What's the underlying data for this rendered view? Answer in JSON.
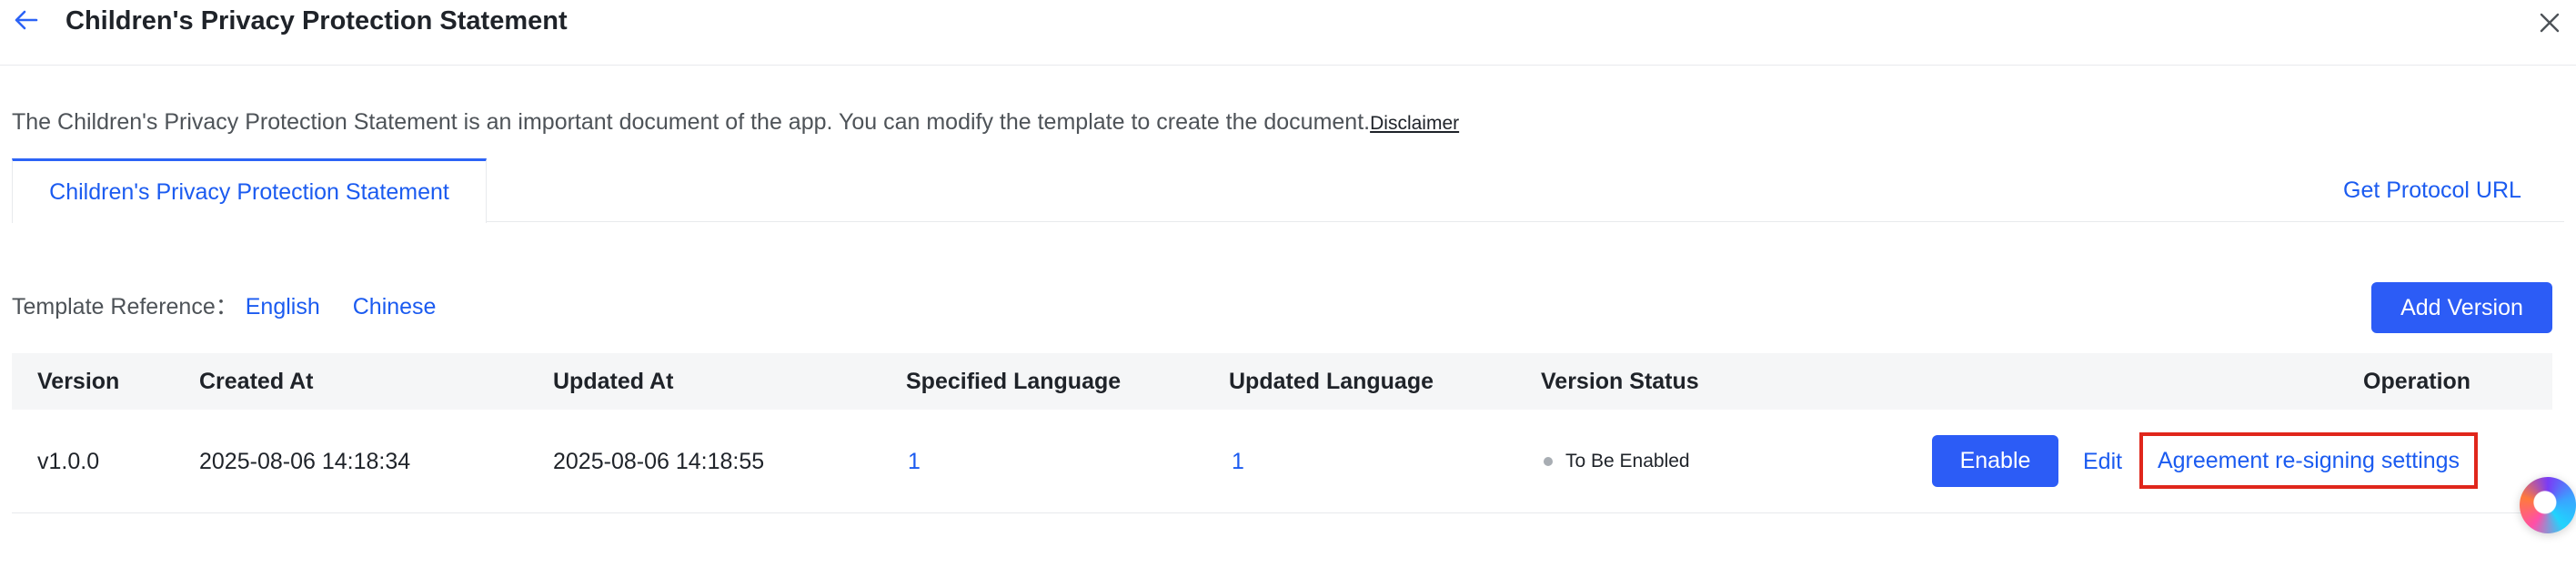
{
  "header": {
    "back_icon": "arrow-left-icon",
    "title": "Children's Privacy Protection Statement",
    "close_icon": "close-icon"
  },
  "description": {
    "text": "The Children's Privacy Protection Statement is an important document of the app. You can modify the template to create the document.",
    "disclaimer_link": "Disclaimer"
  },
  "tabs": [
    {
      "label": "Children's Privacy Protection Statement",
      "active": true
    }
  ],
  "get_protocol_url": "Get Protocol URL",
  "template_reference": {
    "label": "Template Reference：",
    "english": "English",
    "chinese": "Chinese"
  },
  "add_version_button": "Add Version",
  "table": {
    "columns": [
      "Version",
      "Created At",
      "Updated At",
      "Specified Language",
      "Updated Language",
      "Version Status",
      "Operation"
    ],
    "rows": [
      {
        "version": "v1.0.0",
        "created_at": "2025-08-06 14:18:34",
        "updated_at": "2025-08-06 14:18:55",
        "specified_language": "1",
        "updated_language": "1",
        "status": "To Be Enabled",
        "operations": {
          "enable": "Enable",
          "edit": "Edit",
          "resign": "Agreement re-signing settings"
        }
      }
    ]
  },
  "colors": {
    "primary": "#2c5cf6",
    "link": "#1b5bf0",
    "highlight_border": "#e0261b",
    "status_dot": "#a8adb3"
  },
  "floating_assistant_icon": "ai-assistant-icon"
}
